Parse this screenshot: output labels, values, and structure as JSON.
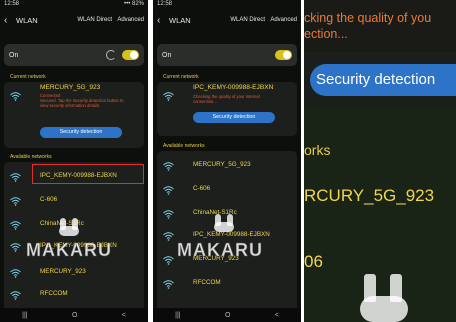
{
  "panel1": {
    "status_time": "12:58",
    "status_right": "••• 82%",
    "title": "WLAN",
    "wlan_direct": "WLAN Direct",
    "advanced": "Advanced",
    "on_label": "On",
    "current_network_label": "Current network",
    "current_ssid": "MERCURY_5G_923",
    "current_status": "Connected",
    "current_desc": "Secured. Tap the Security detection button to view security information details.",
    "detect_button": "Security detection",
    "available_label": "Available networks",
    "networks": [
      "IPC_KEMY-009988-EJBXN",
      "C-606",
      "ChinaNet-S1Rc",
      "IPC_KEMY-009988-EJBXN",
      "MERCURY_923",
      "RFCCOM"
    ],
    "watermark": "MAKARU"
  },
  "panel2": {
    "status_time": "12:58",
    "title": "WLAN",
    "wlan_direct": "WLAN Direct",
    "advanced": "Advanced",
    "on_label": "On",
    "current_network_label": "Current network",
    "current_ssid": "IPC_KEMY-009988-EJBXN",
    "current_desc": "Checking the quality of your internet connection...",
    "detect_button": "Security detection",
    "available_label": "Available networks",
    "networks": [
      "MERCURY_5G_923",
      "C-606",
      "ChinaNet-S1Rc",
      "IPC_KEMY-009988-EJBXN",
      "MERCURY_923",
      "RFCCOM"
    ],
    "watermark": "MAKARU"
  },
  "panel3": {
    "top_text_1": "cking the quality of you",
    "top_text_2": "ection...",
    "button": "Security detection",
    "label": "orks",
    "ssid": "RCURY_5G_923",
    "c606": "06"
  },
  "nav": {
    "recent": "|||",
    "home": "O",
    "back": "<"
  },
  "colors": {
    "accent_yellow": "#f0d64c",
    "wifi_blue": "#7fd3ea",
    "button_blue": "#2d73c7",
    "highlight_red": "#e42d2d"
  }
}
